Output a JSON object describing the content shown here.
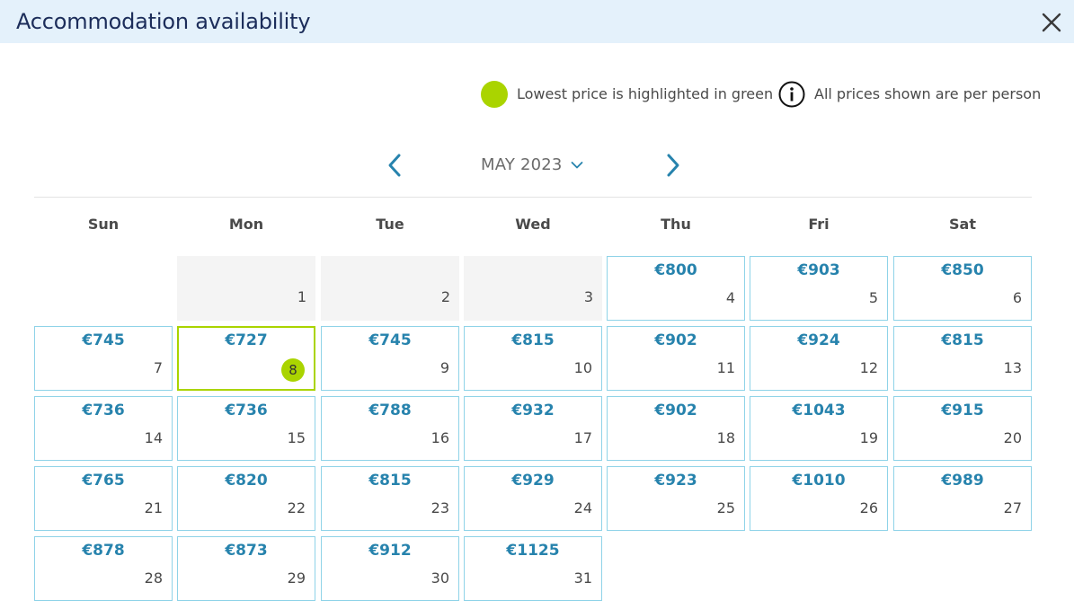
{
  "header": {
    "title": "Accommodation availability"
  },
  "legend": {
    "lowest_price_text": "Lowest price is highlighted in green",
    "per_person_text": "All prices shown are per person"
  },
  "calendar": {
    "month_label": "MAY 2023",
    "weekdays": [
      "Sun",
      "Mon",
      "Tue",
      "Wed",
      "Thu",
      "Fri",
      "Sat"
    ],
    "lowest_day": "8",
    "weeks": [
      [
        null,
        {
          "day": "1",
          "price": ""
        },
        {
          "day": "2",
          "price": ""
        },
        {
          "day": "3",
          "price": ""
        },
        {
          "day": "4",
          "price": "€800"
        },
        {
          "day": "5",
          "price": "€903"
        },
        {
          "day": "6",
          "price": "€850"
        }
      ],
      [
        {
          "day": "7",
          "price": "€745"
        },
        {
          "day": "8",
          "price": "€727"
        },
        {
          "day": "9",
          "price": "€745"
        },
        {
          "day": "10",
          "price": "€815"
        },
        {
          "day": "11",
          "price": "€902"
        },
        {
          "day": "12",
          "price": "€924"
        },
        {
          "day": "13",
          "price": "€815"
        }
      ],
      [
        {
          "day": "14",
          "price": "€736"
        },
        {
          "day": "15",
          "price": "€736"
        },
        {
          "day": "16",
          "price": "€788"
        },
        {
          "day": "17",
          "price": "€932"
        },
        {
          "day": "18",
          "price": "€902"
        },
        {
          "day": "19",
          "price": "€1043"
        },
        {
          "day": "20",
          "price": "€915"
        }
      ],
      [
        {
          "day": "21",
          "price": "€765"
        },
        {
          "day": "22",
          "price": "€820"
        },
        {
          "day": "23",
          "price": "€815"
        },
        {
          "day": "24",
          "price": "€929"
        },
        {
          "day": "25",
          "price": "€923"
        },
        {
          "day": "26",
          "price": "€1010"
        },
        {
          "day": "27",
          "price": "€989"
        }
      ],
      [
        {
          "day": "28",
          "price": "€878"
        },
        {
          "day": "29",
          "price": "€873"
        },
        {
          "day": "30",
          "price": "€912"
        },
        {
          "day": "31",
          "price": "€1125"
        },
        null,
        null,
        null
      ]
    ]
  },
  "colors": {
    "header_bg": "#e4f1fb",
    "title": "#1c2d5a",
    "price": "#2783ad",
    "cell_border": "#8fd3e8",
    "lowest_highlight": "#aad400",
    "unavailable_bg": "#f4f4f4"
  },
  "icons": {
    "close": "close-icon",
    "lowest": "green-dot-icon",
    "info": "info-icon",
    "prev": "chevron-left-icon",
    "next": "chevron-right-icon",
    "month_dropdown": "chevron-down-icon"
  }
}
